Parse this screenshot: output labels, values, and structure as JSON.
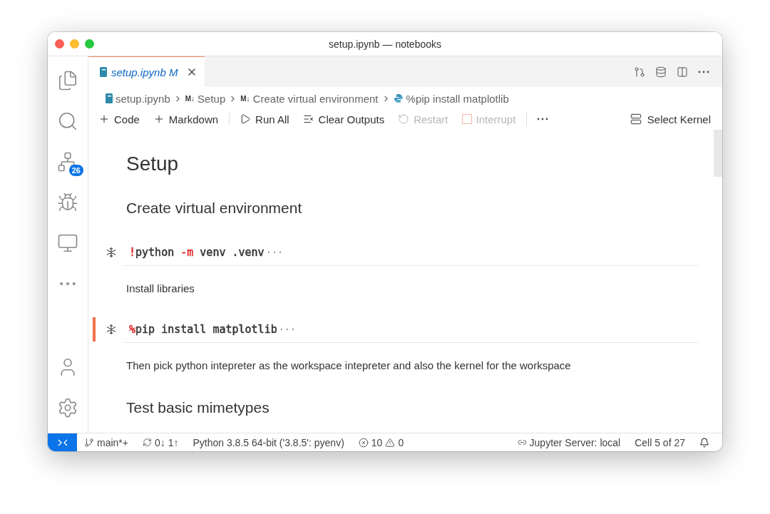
{
  "window": {
    "title": "setup.ipynb — notebooks"
  },
  "activity_bar": {
    "items": [
      {
        "kind": "files",
        "selected": false
      },
      {
        "kind": "search",
        "selected": false
      },
      {
        "kind": "source-control",
        "selected": false,
        "badge": "26"
      },
      {
        "kind": "debug",
        "selected": false
      },
      {
        "kind": "remote",
        "selected": false
      },
      {
        "kind": "more",
        "selected": false
      }
    ],
    "bottom": [
      {
        "kind": "account"
      },
      {
        "kind": "settings"
      }
    ]
  },
  "tabs": [
    {
      "label": "setup.ipynb",
      "status": "M",
      "selected": true
    }
  ],
  "breadcrumbs": [
    {
      "kind": "notebook",
      "label": "setup.ipynb"
    },
    {
      "kind": "markdown",
      "marker": "M↓",
      "label": "Setup"
    },
    {
      "kind": "markdown",
      "marker": "M↓",
      "label": "Create virtual environment"
    },
    {
      "kind": "python",
      "label": "%pip install matplotlib"
    }
  ],
  "toolbar": [
    {
      "kind": "plus",
      "label": "Code",
      "disabled": false
    },
    {
      "kind": "plus",
      "label": "Markdown",
      "disabled": false
    },
    {
      "kind": "separator"
    },
    {
      "kind": "run",
      "label": "Run All",
      "disabled": false
    },
    {
      "kind": "clear",
      "label": "Clear Outputs",
      "disabled": false
    },
    {
      "kind": "restart",
      "label": "Restart",
      "disabled": true
    },
    {
      "kind": "interrupt",
      "label": "Interrupt",
      "disabled": true
    },
    {
      "kind": "separator"
    },
    {
      "kind": "more"
    }
  ],
  "kernel": {
    "label": "Select Kernel"
  },
  "cells": [
    {
      "kind": "h1",
      "text": "Setup"
    },
    {
      "kind": "h2",
      "text": "Create virtual environment"
    },
    {
      "kind": "code",
      "selected": false,
      "tokens": [
        {
          "color": "#e02c2c",
          "text": "!"
        },
        {
          "color": "#333333",
          "text": "python "
        },
        {
          "color": "#e02c2c",
          "text": "-m"
        },
        {
          "color": "#333333",
          "text": " venv .venv"
        }
      ],
      "more": "···"
    },
    {
      "kind": "p",
      "text": "Install libraries"
    },
    {
      "kind": "code",
      "selected": true,
      "tokens": [
        {
          "color": "#e02c2c",
          "text": "%"
        },
        {
          "color": "#333333",
          "text": "pip install matplotlib"
        }
      ],
      "more": "···"
    },
    {
      "kind": "p",
      "text": "Then pick python intepreter as the workspace intepreter and also the kernel for the workspace"
    },
    {
      "kind": "h2",
      "text": "Test basic mimetypes"
    }
  ],
  "status_bar": {
    "left": [
      {
        "kind": "branch",
        "text": "main*+"
      },
      {
        "kind": "sync",
        "text": "0↓ 1↑"
      },
      {
        "kind": "plain",
        "text": "Python 3.8.5 64-bit ('3.8.5': pyenv)"
      },
      {
        "kind": "problems",
        "errors": "10",
        "warnings": "0"
      }
    ],
    "right": [
      {
        "kind": "server",
        "text": "Jupyter Server: local"
      },
      {
        "kind": "plain",
        "text": "Cell 5 of 27"
      },
      {
        "kind": "bell"
      }
    ]
  }
}
